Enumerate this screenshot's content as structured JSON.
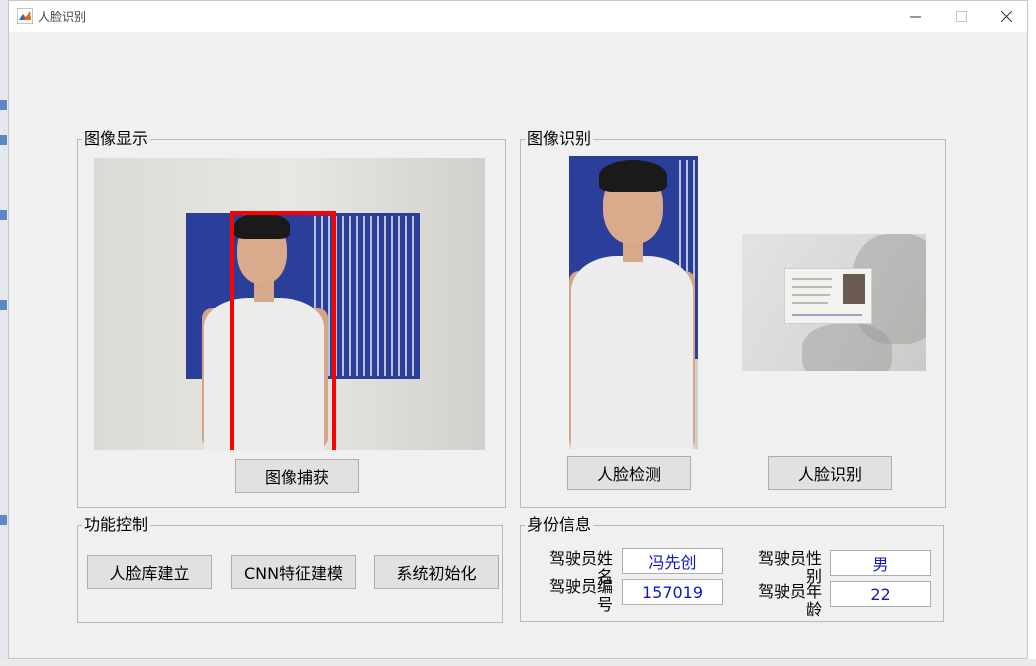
{
  "window": {
    "title": "人脸识别"
  },
  "panels": {
    "image_display": {
      "title": "图像显示",
      "capture_button": "图像捕获"
    },
    "image_recognition": {
      "title": "图像识别",
      "detect_button": "人脸检测",
      "recognize_button": "人脸识别"
    },
    "function_control": {
      "title": "功能控制",
      "build_db_button": "人脸库建立",
      "cnn_button": "CNN特征建模",
      "init_button": "系统初始化"
    },
    "identity": {
      "title": "身份信息",
      "fields": [
        {
          "label": "驾驶员姓名",
          "value": "冯先创"
        },
        {
          "label": "驾驶员性别",
          "value": "男"
        },
        {
          "label": "驾驶员编号",
          "value": "157019"
        },
        {
          "label": "驾驶员年龄",
          "value": "22"
        }
      ]
    }
  },
  "colors": {
    "detect_box": "#ff0000",
    "field_text": "#1414c8",
    "poster": "#2b3f9a"
  }
}
